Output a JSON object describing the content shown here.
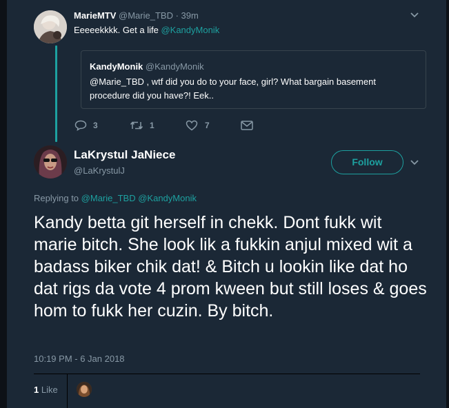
{
  "reply_tweet": {
    "display_name": "MarieMTV",
    "handle": "@Marie_TBD",
    "time": "· 39m",
    "text_prefix": "Eeeeekkkk. Get a life ",
    "text_mention": "@KandyMonik",
    "quoted": {
      "display_name": "KandyMonik",
      "handle": "@KandyMonik",
      "text": "@Marie_TBD , wtf did you do to your face, girl? What bargain basement procedure did you have?! Eek.."
    },
    "actions": {
      "replies": "3",
      "retweets": "1",
      "likes": "7"
    }
  },
  "main_tweet": {
    "display_name": "LaKrystul JaNiece",
    "handle": "@LaKrystulJ",
    "follow_label": "Follow",
    "replying_to_label": "Replying to",
    "replying_to_mentions": "@Marie_TBD @KandyMonik",
    "text": "Kandy betta git herself in chekk. Dont fukk wit marie bitch. She look lik a fukkin anjul mixed wit a badass biker chik dat! & Bitch u lookin like dat ho dat rigs da vote 4 prom kween but still loses & goes hom to fukk her cuzin. By bitch.",
    "timestamp": "10:19 PM - 6 Jan 2018",
    "like_count": "1",
    "like_label": "Like"
  },
  "colors": {
    "background": "#1b2836",
    "accent": "#1da1a0",
    "muted": "#8899a6",
    "text": "#ffffff"
  },
  "icons": [
    "reply-icon",
    "retweet-icon",
    "like-heart-icon",
    "direct-message-icon",
    "chevron-down-icon"
  ]
}
